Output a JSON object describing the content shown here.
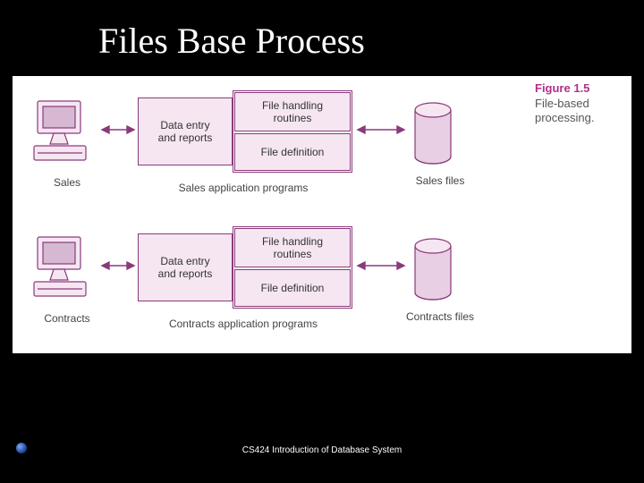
{
  "slide": {
    "title": "Files Base Process",
    "footer": "CS424  Introduction of Database System"
  },
  "figure": {
    "number": "Figure 1.5",
    "caption": "File-based processing.",
    "rows": [
      {
        "terminal_label": "Sales",
        "entry_box": "Data entry\nand reports",
        "file_handling": "File handling\nroutines",
        "file_definition": "File definition",
        "programs_label": "Sales application programs",
        "files_label": "Sales files"
      },
      {
        "terminal_label": "Contracts",
        "entry_box": "Data entry\nand reports",
        "file_handling": "File handling\nroutines",
        "file_definition": "File definition",
        "programs_label": "Contracts application programs",
        "files_label": "Contracts files"
      }
    ]
  }
}
